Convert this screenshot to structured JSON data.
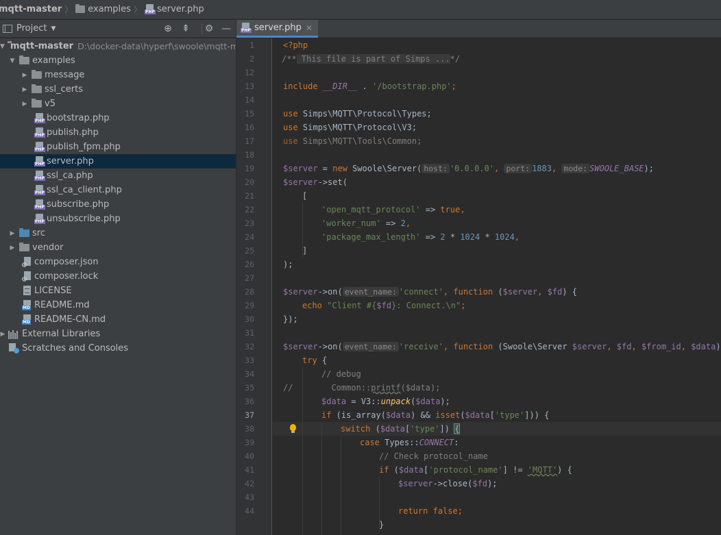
{
  "breadcrumb": {
    "project": "mqtt-master",
    "folder": "examples",
    "file": "server.php"
  },
  "project_panel": {
    "title": "Project",
    "tree": [
      {
        "label": "mqtt-master",
        "path": "D:\\docker-data\\hyperf\\swoole\\mqtt-ma",
        "type": "folder",
        "depth": 0,
        "open": true,
        "bold": true
      },
      {
        "label": "examples",
        "type": "folder",
        "depth": 1,
        "open": true
      },
      {
        "label": "message",
        "type": "folder",
        "depth": 2,
        "open": false
      },
      {
        "label": "ssl_certs",
        "type": "folder",
        "depth": 2,
        "open": false
      },
      {
        "label": "v5",
        "type": "folder",
        "depth": 2,
        "open": false
      },
      {
        "label": "bootstrap.php",
        "type": "php",
        "depth": 2
      },
      {
        "label": "publish.php",
        "type": "php",
        "depth": 2
      },
      {
        "label": "publish_fpm.php",
        "type": "php",
        "depth": 2
      },
      {
        "label": "server.php",
        "type": "php",
        "depth": 2,
        "selected": true
      },
      {
        "label": "ssl_ca.php",
        "type": "php",
        "depth": 2
      },
      {
        "label": "ssl_ca_client.php",
        "type": "php",
        "depth": 2
      },
      {
        "label": "subscribe.php",
        "type": "php",
        "depth": 2
      },
      {
        "label": "unsubscribe.php",
        "type": "php",
        "depth": 2
      },
      {
        "label": "src",
        "type": "folder-blue",
        "depth": 1,
        "open": false
      },
      {
        "label": "vendor",
        "type": "folder",
        "depth": 1,
        "open": false
      },
      {
        "label": "composer.json",
        "type": "composer",
        "depth": 1
      },
      {
        "label": "composer.lock",
        "type": "composer",
        "depth": 1
      },
      {
        "label": "LICENSE",
        "type": "text",
        "depth": 1
      },
      {
        "label": "README.md",
        "type": "md",
        "depth": 1
      },
      {
        "label": "README-CN.md",
        "type": "md",
        "depth": 1
      },
      {
        "label": "External Libraries",
        "type": "libraries",
        "depth": 0,
        "open": false
      },
      {
        "label": "Scratches and Consoles",
        "type": "scratches",
        "depth": 0
      }
    ]
  },
  "editor": {
    "tab_label": "server.php",
    "current_line": 37,
    "line_numbers": [
      "1",
      "2",
      "12",
      "13",
      "14",
      "15",
      "16",
      "17",
      "18",
      "19",
      "20",
      "21",
      "22",
      "23",
      "24",
      "25",
      "26",
      "27",
      "28",
      "29",
      "30",
      "31",
      "32",
      "33",
      "34",
      "35",
      "36",
      "37",
      "38",
      "39",
      "40",
      "41",
      "42",
      "43",
      "44"
    ],
    "code": {
      "l1": "<?php",
      "l2a": "/**",
      "l2b": " This file is part of Simps ...",
      "l2c": "*/",
      "l12a": "include",
      "l12b": " __DIR__ ",
      "l12c": ". ",
      "l12d": "'/bootstrap.php'",
      "l12e": ";",
      "l14a": "use",
      "l14b": " Simps\\MQTT\\Protocol\\Types;",
      "l15a": "use",
      "l15b": " Simps\\MQTT\\Protocol\\V3;",
      "l16a": "use",
      "l16b": " Simps\\MQTT\\Tools\\Common;",
      "l18a": "$server",
      "l18b": " = ",
      "l18c": "new",
      "l18d": " Swoole\\Server(",
      "l18e": "host:",
      "l18f": "'0.0.0.0'",
      "l18g": ", ",
      "l18h": "port:",
      "l18i": "1883",
      "l18j": ", ",
      "l18k": "mode:",
      "l18l": "SWOOLE_BASE",
      "l18m": ");",
      "l19a": "$server",
      "l19b": "->",
      "l19c": "set",
      "l19d": "(",
      "l20": "[",
      "l21a": "'open_mqtt_protocol'",
      "l21b": " => ",
      "l21c": "true",
      "l21d": ",",
      "l22a": "'worker_num'",
      "l22b": " => ",
      "l22c": "2",
      "l22d": ",",
      "l23a": "'package_max_length'",
      "l23b": " => ",
      "l23c": "2",
      "l23d": " * ",
      "l23e": "1024",
      "l23f": " * ",
      "l23g": "1024",
      "l23h": ",",
      "l24": "]",
      "l25": ");",
      "l27a": "$server",
      "l27b": "->",
      "l27c": "on",
      "l27d": "(",
      "l27e": "event_name:",
      "l27f": "'connect'",
      "l27g": ", ",
      "l27h": "function",
      "l27i": " (",
      "l27j": "$server",
      "l27k": ", ",
      "l27l": "$fd",
      "l27m": ") {",
      "l28a": "echo",
      "l28b": " \"Client #{",
      "l28c": "$fd",
      "l28d": "}: Connect.\\n\"",
      "l28e": ";",
      "l29": "});",
      "l31a": "$server",
      "l31b": "->",
      "l31c": "on",
      "l31d": "(",
      "l31e": "event_name:",
      "l31f": "'receive'",
      "l31g": ", ",
      "l31h": "function",
      "l31i": " (Swoole\\Server ",
      "l31j": "$server",
      "l31k": ", ",
      "l31l": "$fd",
      "l31m": ", ",
      "l31n": "$from_id",
      "l31o": ", ",
      "l31p": "$data",
      "l31q": ") {",
      "l32a": "try",
      "l32b": " {",
      "l33": "// debug",
      "l34a": "//",
      "l34b": "Common::",
      "l34c": "printf",
      "l34d": "($data);",
      "l35a": "$data",
      "l35b": " = V3::",
      "l35c": "unpack",
      "l35d": "(",
      "l35e": "$data",
      "l35f": ");",
      "l36a": "if",
      "l36b": " (is_array(",
      "l36c": "$data",
      "l36d": ") && ",
      "l36e": "isset",
      "l36f": "(",
      "l36g": "$data",
      "l36h": "[",
      "l36i": "'type'",
      "l36j": "])) {",
      "l37a": "switch",
      "l37b": " (",
      "l37c": "$data",
      "l37d": "[",
      "l37e": "'type'",
      "l37f": "]) ",
      "l37g": "{",
      "l38a": "case",
      "l38b": " Types::",
      "l38c": "CONNECT",
      "l38d": ":",
      "l39": "// Check protocol_name",
      "l40a": "if",
      "l40b": " (",
      "l40c": "$data",
      "l40d": "[",
      "l40e": "'protocol_name'",
      "l40f": "] != ",
      "l40g": "'MQTT'",
      "l40h": ") {",
      "l41a": "$server",
      "l41b": "->",
      "l41c": "close",
      "l41d": "(",
      "l41e": "$fd",
      "l41f": ");",
      "l43a": "return",
      "l43b": " ",
      "l43c": "false",
      "l43d": ";",
      "l44": "}"
    }
  },
  "colors": {
    "keyword": "#cc7832",
    "variable": "#9876aa",
    "string": "#6a8759",
    "number": "#6897bb",
    "comment": "#808080",
    "selection": "#0d293e"
  }
}
